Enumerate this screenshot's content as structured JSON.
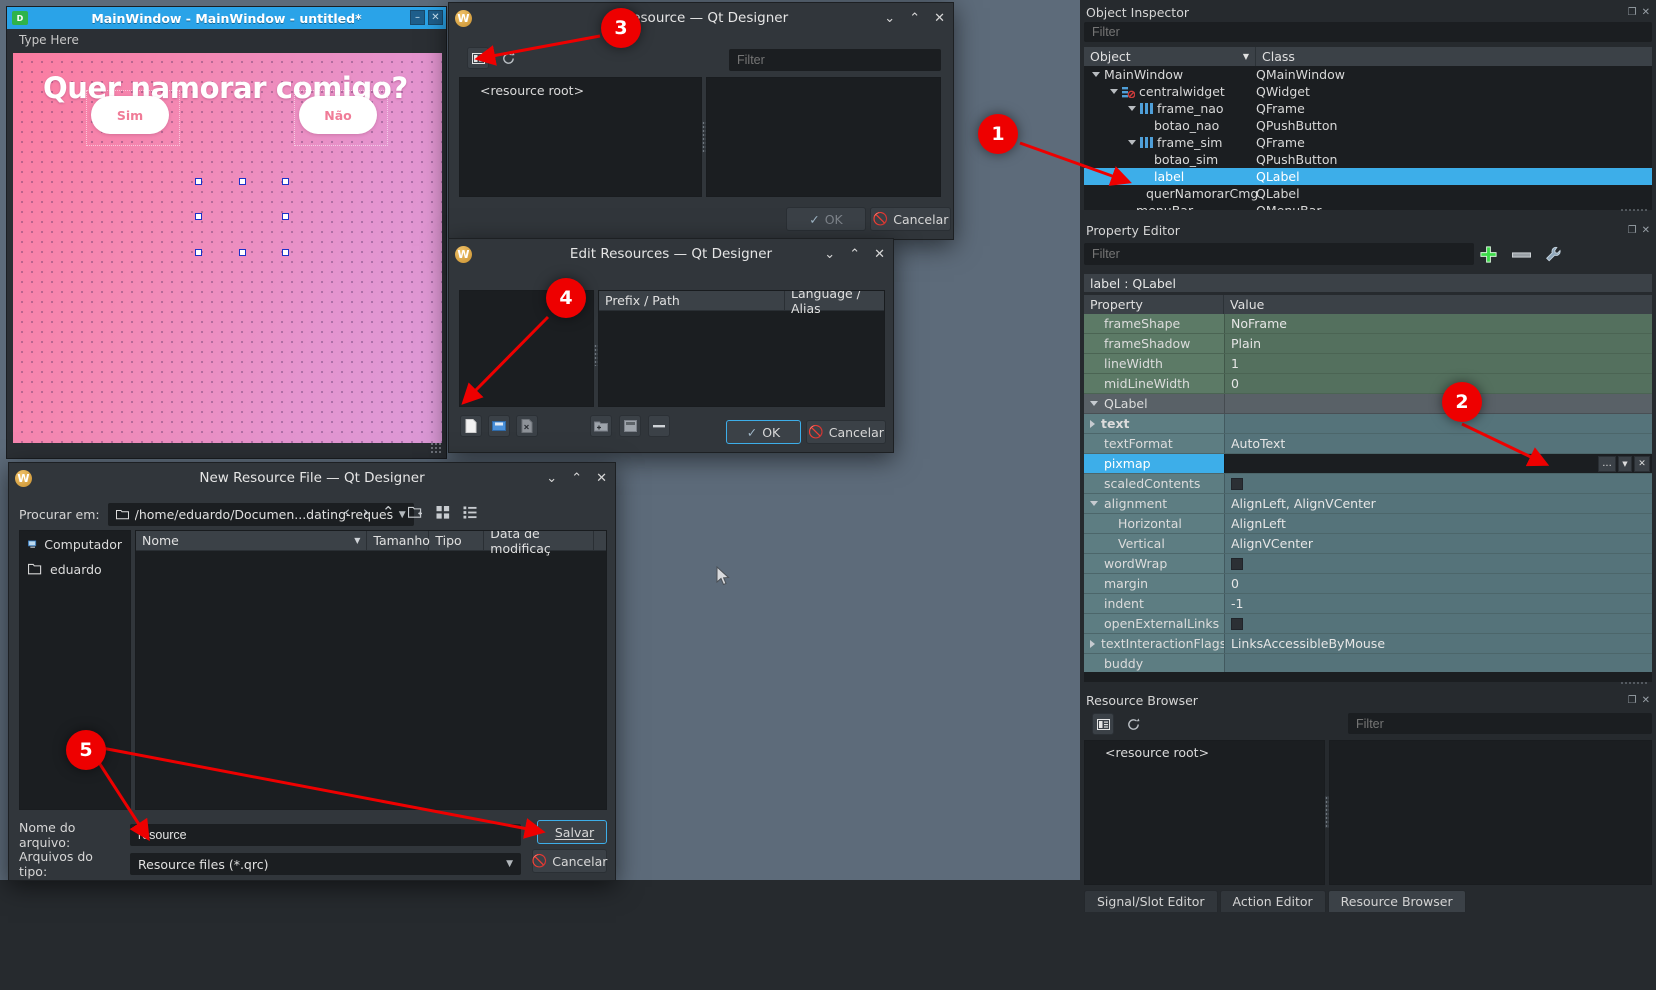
{
  "mainwindow": {
    "title": "MainWindow - MainWindow - untitled*",
    "logo": "D",
    "menubar_hint": "Type Here",
    "heading": "Quer namorar comigo?",
    "btn_sim": "Sim",
    "btn_nao": "Não",
    "min_glyph": "–",
    "close_glyph": "✕"
  },
  "select_resource": {
    "title": "t Resource — Qt Designer",
    "filter_placeholder": "Filter",
    "tree_root": "<resource root>",
    "ok": "OK",
    "cancel": "Cancelar",
    "icon_left": "layout-icon",
    "icon_reload": "reload-icon",
    "ctrl_min": "⌄",
    "ctrl_max": "⌃",
    "ctrl_close": "✕"
  },
  "edit_resources": {
    "title": "Edit Resources — Qt Designer",
    "col_prefix": "Prefix / Path",
    "col_language": "Language / Alias",
    "ok": "OK",
    "cancel": "Cancelar",
    "ctrl_min": "⌄",
    "ctrl_max": "⌃",
    "ctrl_close": "✕"
  },
  "new_resource_file": {
    "title": "New Resource File — Qt Designer",
    "lookin_label": "Procurar em:",
    "path": "/home/eduardo/Documen...dating-request/assets",
    "sidebar": [
      {
        "label": "Computador",
        "icon": "computer-icon"
      },
      {
        "label": "eduardo",
        "icon": "folder-icon"
      }
    ],
    "columns": [
      "Nome",
      "Tamanho",
      "Tipo",
      "Data de modificaç"
    ],
    "filename_label": "Nome do arquivo:",
    "filename_value": "resource",
    "filetype_label": "Arquivos do tipo:",
    "filetype_value": "Resource files (*.qrc)",
    "save": "Salvar",
    "cancel": "Cancelar",
    "ctrl_min": "⌄",
    "ctrl_max": "⌃",
    "ctrl_close": "✕"
  },
  "object_inspector": {
    "title": "Object Inspector",
    "filter_placeholder": "Filter",
    "columns": [
      "Object",
      "Class"
    ],
    "rows": [
      {
        "object": "MainWindow",
        "class": "QMainWindow",
        "indent": 0,
        "expander": true,
        "icon": "",
        "selected": false
      },
      {
        "object": "centralwidget",
        "class": "QWidget",
        "indent": 1,
        "expander": true,
        "icon": "widget-icon",
        "selected": false
      },
      {
        "object": "frame_nao",
        "class": "QFrame",
        "indent": 2,
        "expander": true,
        "icon": "frame-icon",
        "selected": false
      },
      {
        "object": "botao_nao",
        "class": "QPushButton",
        "indent": 3,
        "expander": false,
        "icon": "",
        "selected": false
      },
      {
        "object": "frame_sim",
        "class": "QFrame",
        "indent": 2,
        "expander": true,
        "icon": "frame-icon",
        "selected": false
      },
      {
        "object": "botao_sim",
        "class": "QPushButton",
        "indent": 3,
        "expander": false,
        "icon": "",
        "selected": false
      },
      {
        "object": "label",
        "class": "QLabel",
        "indent": 3,
        "expander": false,
        "icon": "",
        "selected": true
      },
      {
        "object": "querNamorarCmg",
        "class": "QLabel",
        "indent": 3,
        "expander": false,
        "icon": "",
        "selected": false
      },
      {
        "object": "menuBar",
        "class": "QMenuBar",
        "indent": 2,
        "expander": false,
        "icon": "",
        "selected": false
      }
    ]
  },
  "property_editor": {
    "title": "Property Editor",
    "filter_placeholder": "Filter",
    "object_line": "label : QLabel",
    "columns": [
      "Property",
      "Value"
    ],
    "add_icon": "plus-icon",
    "remove_icon": "minus-icon",
    "config_icon": "wrench-icon",
    "rows": [
      {
        "name": "frameShape",
        "value": "NoFrame",
        "group": "g1",
        "indent": 1,
        "expander": "",
        "type": "text"
      },
      {
        "name": "frameShadow",
        "value": "Plain",
        "group": "g1",
        "indent": 1,
        "expander": "",
        "type": "text"
      },
      {
        "name": "lineWidth",
        "value": "1",
        "group": "g1",
        "indent": 1,
        "expander": "",
        "type": "text"
      },
      {
        "name": "midLineWidth",
        "value": "0",
        "group": "g1",
        "indent": 1,
        "expander": "",
        "type": "text"
      },
      {
        "name": "QLabel",
        "value": "",
        "group": "grp",
        "indent": 0,
        "expander": "down",
        "type": "text"
      },
      {
        "name": "text",
        "value": "",
        "group": "g2",
        "indent": 0,
        "expander": "right",
        "type": "bold"
      },
      {
        "name": "textFormat",
        "value": "AutoText",
        "group": "g2",
        "indent": 1,
        "expander": "",
        "type": "text"
      },
      {
        "name": "pixmap",
        "value": "",
        "group": "sel",
        "indent": 1,
        "expander": "",
        "type": "text"
      },
      {
        "name": "scaledContents",
        "value": "",
        "group": "g2",
        "indent": 1,
        "expander": "",
        "type": "check"
      },
      {
        "name": "alignment",
        "value": "AlignLeft, AlignVCenter",
        "group": "g2",
        "indent": 0,
        "expander": "down",
        "type": "text"
      },
      {
        "name": "Horizontal",
        "value": "AlignLeft",
        "group": "g2",
        "indent": 2,
        "expander": "",
        "type": "text"
      },
      {
        "name": "Vertical",
        "value": "AlignVCenter",
        "group": "g2",
        "indent": 2,
        "expander": "",
        "type": "text"
      },
      {
        "name": "wordWrap",
        "value": "",
        "group": "g2",
        "indent": 1,
        "expander": "",
        "type": "check"
      },
      {
        "name": "margin",
        "value": "0",
        "group": "g2",
        "indent": 1,
        "expander": "",
        "type": "text"
      },
      {
        "name": "indent",
        "value": "-1",
        "group": "g2",
        "indent": 1,
        "expander": "",
        "type": "text"
      },
      {
        "name": "openExternalLinks",
        "value": "",
        "group": "g2",
        "indent": 1,
        "expander": "",
        "type": "check"
      },
      {
        "name": "textInteractionFlags",
        "value": "LinksAccessibleByMouse",
        "group": "g2",
        "indent": 0,
        "expander": "right",
        "type": "text"
      },
      {
        "name": "buddy",
        "value": "",
        "group": "g2",
        "indent": 1,
        "expander": "",
        "type": "text"
      }
    ]
  },
  "resource_browser": {
    "title": "Resource Browser",
    "filter_placeholder": "Filter",
    "tree_root": "<resource root>",
    "icon_left": "layout-icon",
    "icon_reload": "reload-icon"
  },
  "dock_tabs": [
    {
      "label": "Signal/Slot Editor",
      "active": false
    },
    {
      "label": "Action Editor",
      "active": false
    },
    {
      "label": "Resource Browser",
      "active": true
    }
  ],
  "annotations": [
    {
      "n": "1"
    },
    {
      "n": "2"
    },
    {
      "n": "3"
    },
    {
      "n": "4"
    },
    {
      "n": "5"
    }
  ],
  "colors": {
    "accent": "#3daee9",
    "annotation": "#ee0000",
    "titlebar": "#2aa3e8",
    "prop_green": "#5c7a66",
    "prop_teal": "#5d7d82"
  }
}
